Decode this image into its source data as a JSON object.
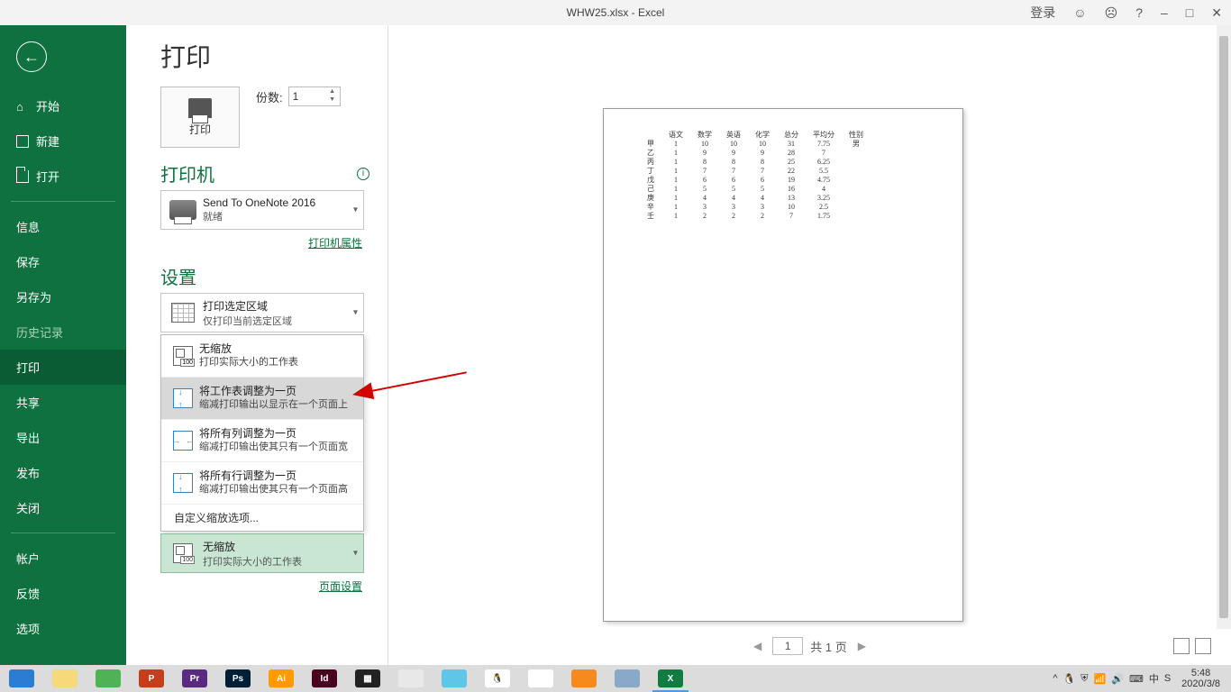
{
  "titlebar": {
    "title": "WHW25.xlsx  -  Excel",
    "login": "登录",
    "help": "?",
    "min": "–",
    "max": "□",
    "close": "✕"
  },
  "sidebar": {
    "back": "←",
    "items": [
      {
        "label": "开始",
        "icon": "home"
      },
      {
        "label": "新建",
        "icon": "new"
      },
      {
        "label": "打开",
        "icon": "open"
      }
    ],
    "items2": [
      {
        "label": "信息"
      },
      {
        "label": "保存"
      },
      {
        "label": "另存为"
      },
      {
        "label": "历史记录",
        "dim": true
      },
      {
        "label": "打印",
        "selected": true
      },
      {
        "label": "共享"
      },
      {
        "label": "导出"
      },
      {
        "label": "发布"
      },
      {
        "label": "关闭"
      }
    ],
    "items3": [
      {
        "label": "帐户"
      },
      {
        "label": "反馈"
      },
      {
        "label": "选项"
      }
    ]
  },
  "print": {
    "heading": "打印",
    "button": "打印",
    "copies_label": "份数:",
    "copies_value": "1",
    "printer_heading": "打印机",
    "printer_name": "Send To OneNote 2016",
    "printer_status": "就绪",
    "printer_props": "打印机属性",
    "settings_heading": "设置",
    "area_title": "打印选定区域",
    "area_sub": "仅打印当前选定区域",
    "scale_options": [
      {
        "t1": "无缩放",
        "t2": "打印实际大小的工作表"
      },
      {
        "t1": "将工作表调整为一页",
        "t2": "缩减打印输出以显示在一个页面上",
        "hl": true
      },
      {
        "t1": "将所有列调整为一页",
        "t2": "缩减打印输出使其只有一个页面宽"
      },
      {
        "t1": "将所有行调整为一页",
        "t2": "缩减打印输出使其只有一个页面高"
      }
    ],
    "custom_scale": "自定义缩放选项...",
    "current_scale_t1": "无缩放",
    "current_scale_t2": "打印实际大小的工作表",
    "page_setup": "页面设置"
  },
  "pagenav": {
    "current": "1",
    "total": "共 1 页"
  },
  "chart_data": {
    "type": "table",
    "headers": [
      "",
      "语文",
      "数学",
      "英语",
      "化学",
      "总分",
      "平均分",
      "性别"
    ],
    "rows": [
      [
        "甲",
        "1",
        "10",
        "10",
        "10",
        "31",
        "7.75",
        "男"
      ],
      [
        "乙",
        "1",
        "9",
        "9",
        "9",
        "28",
        "7",
        ""
      ],
      [
        "丙",
        "1",
        "8",
        "8",
        "8",
        "25",
        "6.25",
        ""
      ],
      [
        "丁",
        "1",
        "7",
        "7",
        "7",
        "22",
        "5.5",
        ""
      ],
      [
        "戊",
        "1",
        "6",
        "6",
        "6",
        "19",
        "4.75",
        ""
      ],
      [
        "己",
        "1",
        "5",
        "5",
        "5",
        "16",
        "4",
        ""
      ],
      [
        "庚",
        "1",
        "4",
        "4",
        "4",
        "13",
        "3.25",
        ""
      ],
      [
        "辛",
        "1",
        "3",
        "3",
        "3",
        "10",
        "2.5",
        ""
      ],
      [
        "壬",
        "1",
        "2",
        "2",
        "2",
        "7",
        "1.75",
        ""
      ]
    ]
  },
  "taskbar": {
    "apps": [
      {
        "bg": "#2b7cd3",
        "txt": ""
      },
      {
        "bg": "#f5d97a",
        "txt": ""
      },
      {
        "bg": "#4fb355",
        "txt": ""
      },
      {
        "bg": "#c43e1c",
        "txt": "P"
      },
      {
        "bg": "#5a2a82",
        "txt": "Pr"
      },
      {
        "bg": "#001e36",
        "txt": "Ps"
      },
      {
        "bg": "#ff9a00",
        "txt": "Ai"
      },
      {
        "bg": "#49021f",
        "txt": "Id"
      },
      {
        "bg": "#222",
        "txt": "▦"
      },
      {
        "bg": "#e8e8e8",
        "txt": ""
      },
      {
        "bg": "#5ec7e8",
        "txt": ""
      },
      {
        "bg": "#fff",
        "txt": "🐧"
      },
      {
        "bg": "#fff",
        "txt": ""
      },
      {
        "bg": "#f58b1f",
        "txt": ""
      },
      {
        "bg": "#8aa9c9",
        "txt": ""
      },
      {
        "bg": "#107c41",
        "txt": "X",
        "active": true
      }
    ],
    "tray": [
      "^",
      "🐧",
      "⛨",
      "📶",
      "🔊",
      "⌨",
      "中",
      "S"
    ],
    "time": "5:48",
    "date": "2020/3/8"
  }
}
